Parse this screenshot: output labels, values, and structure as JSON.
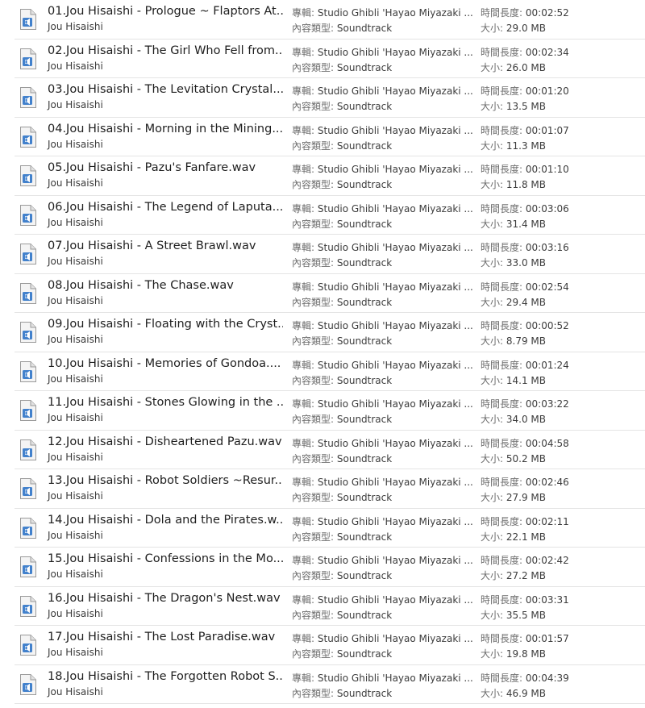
{
  "labels": {
    "album": "專輯:",
    "content_type": "內容類型:",
    "duration": "時間長度:",
    "size": "大小:"
  },
  "colors": {
    "icon_page": "#f4f4f4",
    "icon_border": "#9a9a9a",
    "icon_accent": "#2f74c8",
    "divider": "#e4e4e4"
  },
  "icon": "audio-file-icon",
  "files": [
    {
      "name": "01.Jou Hisaishi - Prologue ~ Flaptors At...",
      "artist": "Jou Hisaishi",
      "album": "Studio Ghibli 'Hayao Miyazaki ...",
      "content_type": "Soundtrack",
      "duration": "00:02:52",
      "size": "29.0 MB"
    },
    {
      "name": "02.Jou Hisaishi - The Girl Who Fell from...",
      "artist": "Jou Hisaishi",
      "album": "Studio Ghibli 'Hayao Miyazaki ...",
      "content_type": "Soundtrack",
      "duration": "00:02:34",
      "size": "26.0 MB"
    },
    {
      "name": "03.Jou Hisaishi - The Levitation Crystal....",
      "artist": "Jou Hisaishi",
      "album": "Studio Ghibli 'Hayao Miyazaki ...",
      "content_type": "Soundtrack",
      "duration": "00:01:20",
      "size": "13.5 MB"
    },
    {
      "name": "04.Jou Hisaishi - Morning in the Mining...",
      "artist": "Jou Hisaishi",
      "album": "Studio Ghibli 'Hayao Miyazaki ...",
      "content_type": "Soundtrack",
      "duration": "00:01:07",
      "size": "11.3 MB"
    },
    {
      "name": "05.Jou Hisaishi - Pazu's Fanfare.wav",
      "artist": "Jou Hisaishi",
      "album": "Studio Ghibli 'Hayao Miyazaki ...",
      "content_type": "Soundtrack",
      "duration": "00:01:10",
      "size": "11.8 MB"
    },
    {
      "name": "06.Jou Hisaishi - The Legend of Laputa....",
      "artist": "Jou Hisaishi",
      "album": "Studio Ghibli 'Hayao Miyazaki ...",
      "content_type": "Soundtrack",
      "duration": "00:03:06",
      "size": "31.4 MB"
    },
    {
      "name": "07.Jou Hisaishi - A Street Brawl.wav",
      "artist": "Jou Hisaishi",
      "album": "Studio Ghibli 'Hayao Miyazaki ...",
      "content_type": "Soundtrack",
      "duration": "00:03:16",
      "size": "33.0 MB"
    },
    {
      "name": "08.Jou Hisaishi - The Chase.wav",
      "artist": "Jou Hisaishi",
      "album": "Studio Ghibli 'Hayao Miyazaki ...",
      "content_type": "Soundtrack",
      "duration": "00:02:54",
      "size": "29.4 MB"
    },
    {
      "name": "09.Jou Hisaishi - Floating with the Cryst...",
      "artist": "Jou Hisaishi",
      "album": "Studio Ghibli 'Hayao Miyazaki ...",
      "content_type": "Soundtrack",
      "duration": "00:00:52",
      "size": "8.79 MB"
    },
    {
      "name": "10.Jou Hisaishi - Memories of Gondoa....",
      "artist": "Jou Hisaishi",
      "album": "Studio Ghibli 'Hayao Miyazaki ...",
      "content_type": "Soundtrack",
      "duration": "00:01:24",
      "size": "14.1 MB"
    },
    {
      "name": "11.Jou Hisaishi - Stones Glowing in the ...",
      "artist": "Jou Hisaishi",
      "album": "Studio Ghibli 'Hayao Miyazaki ...",
      "content_type": "Soundtrack",
      "duration": "00:03:22",
      "size": "34.0 MB"
    },
    {
      "name": "12.Jou Hisaishi - Disheartened Pazu.wav",
      "artist": "Jou Hisaishi",
      "album": "Studio Ghibli 'Hayao Miyazaki ...",
      "content_type": "Soundtrack",
      "duration": "00:04:58",
      "size": "50.2 MB"
    },
    {
      "name": "13.Jou Hisaishi - Robot Soldiers ~Resur...",
      "artist": "Jou Hisaishi",
      "album": "Studio Ghibli 'Hayao Miyazaki ...",
      "content_type": "Soundtrack",
      "duration": "00:02:46",
      "size": "27.9 MB"
    },
    {
      "name": "14.Jou Hisaishi - Dola and the Pirates.w...",
      "artist": "Jou Hisaishi",
      "album": "Studio Ghibli 'Hayao Miyazaki ...",
      "content_type": "Soundtrack",
      "duration": "00:02:11",
      "size": "22.1 MB"
    },
    {
      "name": "15.Jou Hisaishi - Confessions in the Mo...",
      "artist": "Jou Hisaishi",
      "album": "Studio Ghibli 'Hayao Miyazaki ...",
      "content_type": "Soundtrack",
      "duration": "00:02:42",
      "size": "27.2 MB"
    },
    {
      "name": "16.Jou Hisaishi - The Dragon's Nest.wav",
      "artist": "Jou Hisaishi",
      "album": "Studio Ghibli 'Hayao Miyazaki ...",
      "content_type": "Soundtrack",
      "duration": "00:03:31",
      "size": "35.5 MB"
    },
    {
      "name": "17.Jou Hisaishi - The Lost Paradise.wav",
      "artist": "Jou Hisaishi",
      "album": "Studio Ghibli 'Hayao Miyazaki ...",
      "content_type": "Soundtrack",
      "duration": "00:01:57",
      "size": "19.8 MB"
    },
    {
      "name": "18.Jou Hisaishi - The Forgotten Robot S...",
      "artist": "Jou Hisaishi",
      "album": "Studio Ghibli 'Hayao Miyazaki ...",
      "content_type": "Soundtrack",
      "duration": "00:04:39",
      "size": "46.9 MB"
    }
  ]
}
